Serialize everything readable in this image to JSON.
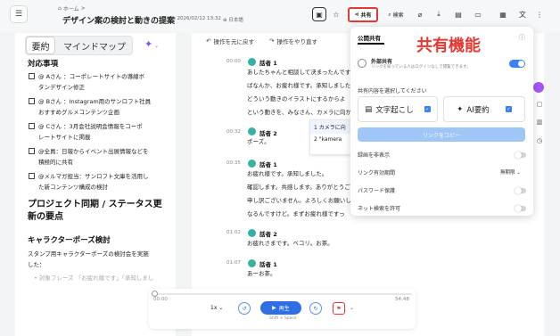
{
  "topbar": {
    "breadcrumb": [
      "ホーム",
      ">"
    ],
    "title": "デザイン案の検討と動きの提案",
    "date": "2026/02/12 13:32",
    "lang": "日本語",
    "share_label": "共有",
    "search_label": "検索",
    "icons": [
      "layout-icon",
      "star-icon",
      "share-icon",
      "search-icon",
      "attach-icon",
      "download-icon",
      "image-icon",
      "folder-icon",
      "save-icon",
      "translate-icon",
      "more-icon"
    ]
  },
  "left": {
    "tab_summary": "要約",
    "tab_mindmap": "マインドマップ",
    "section_todo": "対応事項",
    "todos": [
      "@ Aさん ：コーポレートサイトの導線ボ",
      "タンデザイン修正",
      "@ Bさん ：Instagram用のサンロフト社員",
      "おすすめグルメコンテンツ企画",
      "@ Cさん ：3月会社説明会情報をコーポ",
      "レートサイトに掲載",
      "@全員：日報からイベント出展情報などを",
      "積極的に共有",
      "@メルマガ担当：サンロフト文庫を活用し",
      "た新コンテンツ構成の検討"
    ],
    "section_sync_1": "プロジェクト同期 / ステータス更",
    "section_sync_2": "新の要点",
    "section_character": "キャラクターポーズ検討",
    "para_1": "スタンプ用キャラクターポーズの検討会を実施",
    "para_2": "した：",
    "para_3": "• 対象フレーズ 「お疲れ様です」「承知しまし"
  },
  "main": {
    "undo": "操作を元に戻す",
    "redo": "操作をやり直す",
    "entries": [
      {
        "time": "00:00",
        "speaker": "話者 1",
        "lines": [
          "あしたちゃんと相談して決まったんです",
          "ばなんか、お疲れ様です。承知しました",
          "",
          " どういう動きのイラストにするからよ",
          "という動きを、みなさん、カメラに向か"
        ]
      },
      {
        "time": "00:32",
        "speaker": "話者 2",
        "lines": [
          "ポーズ。"
        ]
      },
      {
        "time": "00:35",
        "speaker": "話者 1",
        "lines": [
          "お疲れ様です。承知しました。",
          "",
          "確認します。共感します。ありがとうご",
          "申し訳ございません。よろしくお願いし",
          "なるんですけど。まずお疲れ様ですっ"
        ]
      },
      {
        "time": "01:02",
        "speaker": "話者 2",
        "lines": [
          "お疲れさまです。ベコリ。お茶。"
        ]
      },
      {
        "time": "01:07",
        "speaker": "話者 1",
        "lines": [
          "あーお茶。"
        ]
      }
    ],
    "context_items": [
      "1 カメラに向",
      "2 \"kamera"
    ]
  },
  "share_popup": {
    "heading": "公開共有",
    "annotation": "共有機能",
    "external_title": "外部共有",
    "external_desc": "リンクを知っている人はログインなしで閲覧できます。",
    "select_label": "共有内容を選択してください",
    "card_transcript": "文字起こし",
    "card_summary": "AI要約",
    "copy_link": "リンクをコピー",
    "options": [
      "録画を非表示",
      "リンク有効期間",
      "パスワード保護",
      "ネット検索を許可"
    ],
    "validity_value": "無期限"
  },
  "player": {
    "current": "00:00",
    "total": "54:48",
    "speed": "1x",
    "play": "再生",
    "hint": "Shift + Space"
  },
  "colors": {
    "accent": "#2f6fe4",
    "annotation": "#e53935",
    "avatar": "#34b3a0"
  }
}
